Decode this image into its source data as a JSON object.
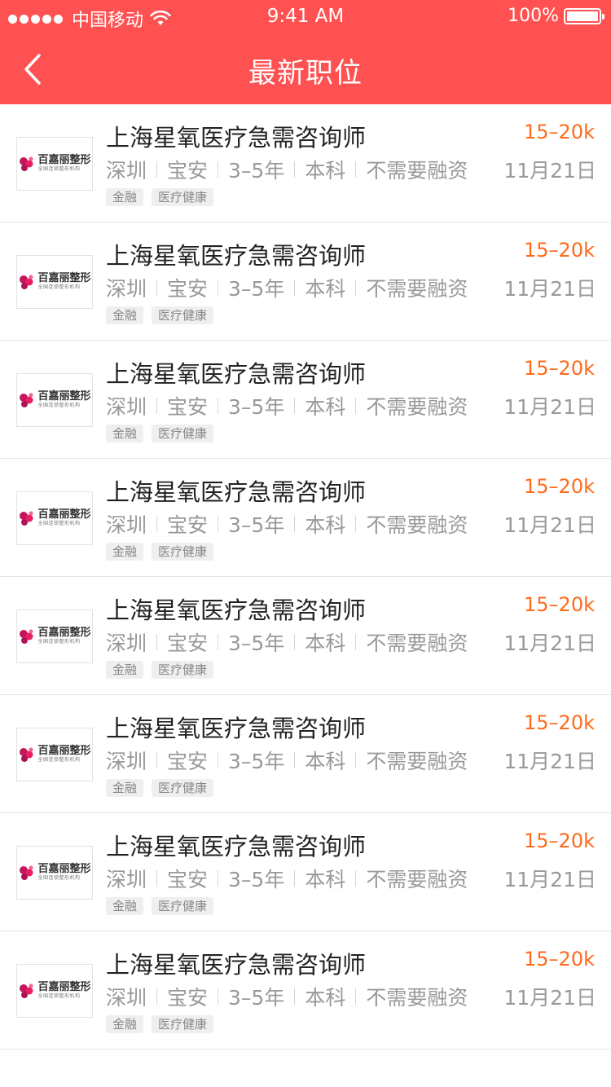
{
  "status_bar": {
    "carrier": "中国移动",
    "time": "9:41 AM",
    "battery": "100%"
  },
  "nav": {
    "title": "最新职位"
  },
  "colors": {
    "header_bg": "#ff5151",
    "salary": "#ff6a1a"
  },
  "jobs": [
    {
      "title": "上海星氧医疗急需咨询师",
      "salary": "15–20k",
      "city": "深圳",
      "district": "宝安",
      "experience": "3–5年",
      "education": "本科",
      "funding": "不需要融资",
      "date": "11月21日",
      "tags": [
        "金融",
        "医疗健康"
      ],
      "company_logo": {
        "name": "百嘉丽整形",
        "sub": "全国连锁整形机构"
      }
    },
    {
      "title": "上海星氧医疗急需咨询师",
      "salary": "15–20k",
      "city": "深圳",
      "district": "宝安",
      "experience": "3–5年",
      "education": "本科",
      "funding": "不需要融资",
      "date": "11月21日",
      "tags": [
        "金融",
        "医疗健康"
      ],
      "company_logo": {
        "name": "百嘉丽整形",
        "sub": "全国连锁整形机构"
      }
    },
    {
      "title": "上海星氧医疗急需咨询师",
      "salary": "15–20k",
      "city": "深圳",
      "district": "宝安",
      "experience": "3–5年",
      "education": "本科",
      "funding": "不需要融资",
      "date": "11月21日",
      "tags": [
        "金融",
        "医疗健康"
      ],
      "company_logo": {
        "name": "百嘉丽整形",
        "sub": "全国连锁整形机构"
      }
    },
    {
      "title": "上海星氧医疗急需咨询师",
      "salary": "15–20k",
      "city": "深圳",
      "district": "宝安",
      "experience": "3–5年",
      "education": "本科",
      "funding": "不需要融资",
      "date": "11月21日",
      "tags": [
        "金融",
        "医疗健康"
      ],
      "company_logo": {
        "name": "百嘉丽整形",
        "sub": "全国连锁整形机构"
      }
    },
    {
      "title": "上海星氧医疗急需咨询师",
      "salary": "15–20k",
      "city": "深圳",
      "district": "宝安",
      "experience": "3–5年",
      "education": "本科",
      "funding": "不需要融资",
      "date": "11月21日",
      "tags": [
        "金融",
        "医疗健康"
      ],
      "company_logo": {
        "name": "百嘉丽整形",
        "sub": "全国连锁整形机构"
      }
    },
    {
      "title": "上海星氧医疗急需咨询师",
      "salary": "15–20k",
      "city": "深圳",
      "district": "宝安",
      "experience": "3–5年",
      "education": "本科",
      "funding": "不需要融资",
      "date": "11月21日",
      "tags": [
        "金融",
        "医疗健康"
      ],
      "company_logo": {
        "name": "百嘉丽整形",
        "sub": "全国连锁整形机构"
      }
    },
    {
      "title": "上海星氧医疗急需咨询师",
      "salary": "15–20k",
      "city": "深圳",
      "district": "宝安",
      "experience": "3–5年",
      "education": "本科",
      "funding": "不需要融资",
      "date": "11月21日",
      "tags": [
        "金融",
        "医疗健康"
      ],
      "company_logo": {
        "name": "百嘉丽整形",
        "sub": "全国连锁整形机构"
      }
    },
    {
      "title": "上海星氧医疗急需咨询师",
      "salary": "15–20k",
      "city": "深圳",
      "district": "宝安",
      "experience": "3–5年",
      "education": "本科",
      "funding": "不需要融资",
      "date": "11月21日",
      "tags": [
        "金融",
        "医疗健康"
      ],
      "company_logo": {
        "name": "百嘉丽整形",
        "sub": "全国连锁整形机构"
      }
    }
  ]
}
